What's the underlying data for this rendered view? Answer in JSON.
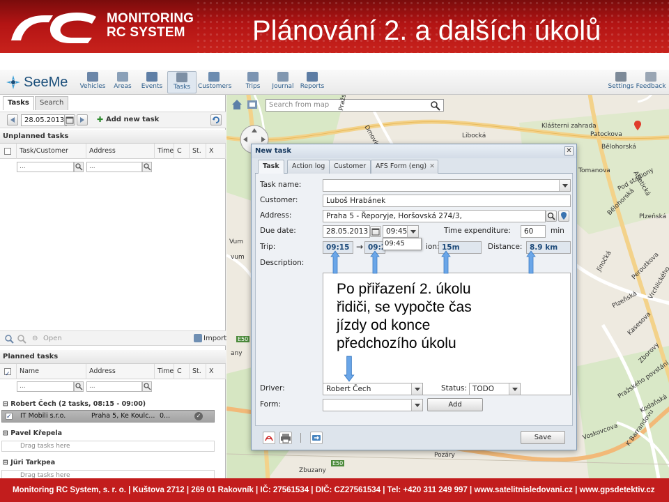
{
  "banner": {
    "logo_line1": "MONITORING",
    "logo_line2": "RC SYSTEM",
    "title": "Plánování 2. a dalších úkolů"
  },
  "footer": {
    "text": "Monitoring RC System, s. r. o. | Kuštova 2712 | 269 01 Rakovník | IČ: 27561534 | DIČ: CZ27561534 | Tel: +420 311 249 997 | www.satelitnisledovani.cz | www.gpsdetektiv.cz"
  },
  "app": {
    "brand": "SeeMe",
    "nav": [
      {
        "label": "Vehicles",
        "icon": "truck-icon"
      },
      {
        "label": "Areas",
        "icon": "areas-icon"
      },
      {
        "label": "Events",
        "icon": "events-icon"
      },
      {
        "label": "Tasks",
        "icon": "tasks-icon"
      },
      {
        "label": "Customers",
        "icon": "customers-icon"
      },
      {
        "label": "Trips",
        "icon": "trips-icon"
      },
      {
        "label": "Journal",
        "icon": "journal-icon"
      },
      {
        "label": "Reports",
        "icon": "reports-icon"
      }
    ],
    "right_nav": [
      {
        "label": "Settings",
        "icon": "settings-icon"
      },
      {
        "label": "Feedback",
        "icon": "feedback-icon"
      }
    ]
  },
  "left": {
    "tabs": [
      "Tasks",
      "Search"
    ],
    "date": "28.05.2013",
    "add_new_task": "Add new task",
    "unplanned_title": "Unplanned tasks",
    "unplanned_cols": [
      "Task/Customer name",
      "Address",
      "Time",
      "C",
      "St.",
      "X"
    ],
    "filter_placeholder": "...",
    "open_label": "Open",
    "import_label": "Import",
    "planned_title": "Planned tasks",
    "planned_cols": [
      "Name",
      "Address",
      "Time",
      "C",
      "St.",
      "X"
    ],
    "groups": [
      {
        "title": "Robert Čech (2 tasks, 08:15 - 09:00)"
      },
      {
        "title": "Pavel Křepela",
        "drop": "Drag tasks here"
      },
      {
        "title": "Jüri Tarkpea",
        "drop": "Drag tasks here"
      }
    ],
    "task_row": {
      "name": "IT Mobili s.r.o.",
      "address": "Praha 5, Ke Koulc...",
      "time": "0..."
    }
  },
  "map": {
    "search_placeholder": "Search from map",
    "labels": [
      "Pražský ok",
      "Dmovka",
      "Libocká",
      "Klášterni zahrada",
      "Patockova",
      "Bělohorská",
      "Tomanova",
      "Pod stadiony",
      "Atletická",
      "Plzeňská",
      "Bělohorská",
      "Jinočká",
      "Peroutkova",
      "Vrchlického",
      "Plzeňská",
      "Kasesova",
      "Zborovy",
      "Pražského povstání",
      "Kodaňská",
      "Voskovcova",
      "K Barrandovu",
      "Zbuzany",
      "Pozáry",
      "E50",
      "E50",
      "Vum",
      "vum",
      "any"
    ]
  },
  "dialog": {
    "title": "New task",
    "tabs": [
      "Task",
      "Action log",
      "Customer",
      "AFS Form (eng)"
    ],
    "labels": {
      "task_name": "Task name:",
      "customer": "Customer:",
      "address": "Address:",
      "due_date": "Due date:",
      "time_exp": "Time expenditure:",
      "trip": "Trip:",
      "distance": "Distance:",
      "description": "Description:",
      "driver": "Driver:",
      "status": "Status:",
      "form": "Form:"
    },
    "values": {
      "customer": "Luboš Hrabánek",
      "address": "Praha 5 - Řeporyje, Horšovská 274/3,",
      "due_date": "28.05.2013",
      "due_time": "09:45",
      "time_option": "09:45",
      "time_exp": "60",
      "time_exp_unit": "min",
      "trip_start": "09:15",
      "trip_arrow": "→",
      "trip_end": "09:2",
      "duration_label_tail": "ion:",
      "duration": "15m",
      "distance": "8.9 km",
      "driver": "Robert Čech",
      "status": "TODO"
    },
    "add_button": "Add",
    "save_button": "Save"
  },
  "annotation": {
    "lines": [
      "Po přiřazení 2. úkolu",
      "řidiči, se vypočte čas",
      "jízdy od konce",
      "předchozího úkolu"
    ],
    "color": "#6aa6e8"
  }
}
